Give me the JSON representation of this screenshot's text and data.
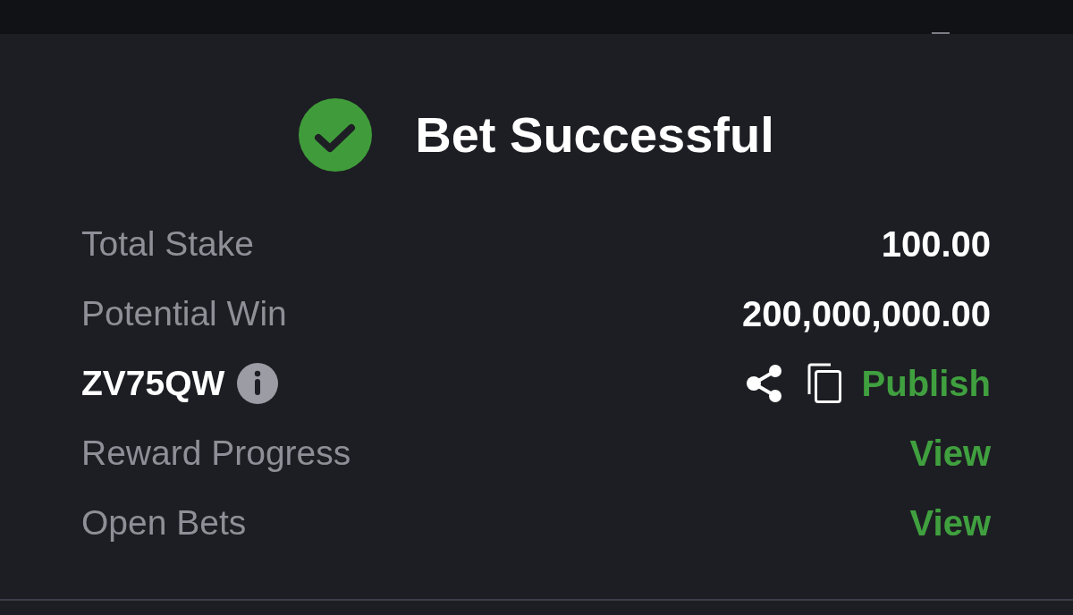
{
  "header": {
    "title": "Bet Successful"
  },
  "rows": [
    {
      "kind": "amount",
      "label": "Total Stake",
      "value": "100.00"
    },
    {
      "kind": "amount",
      "label": "Potential Win",
      "value": "200,000,000.00"
    },
    {
      "kind": "code",
      "code": "ZV75QW",
      "action": "Publish"
    },
    {
      "kind": "link",
      "label": "Reward Progress",
      "action": "View"
    },
    {
      "kind": "link",
      "label": "Open Bets",
      "action": "View"
    }
  ]
}
